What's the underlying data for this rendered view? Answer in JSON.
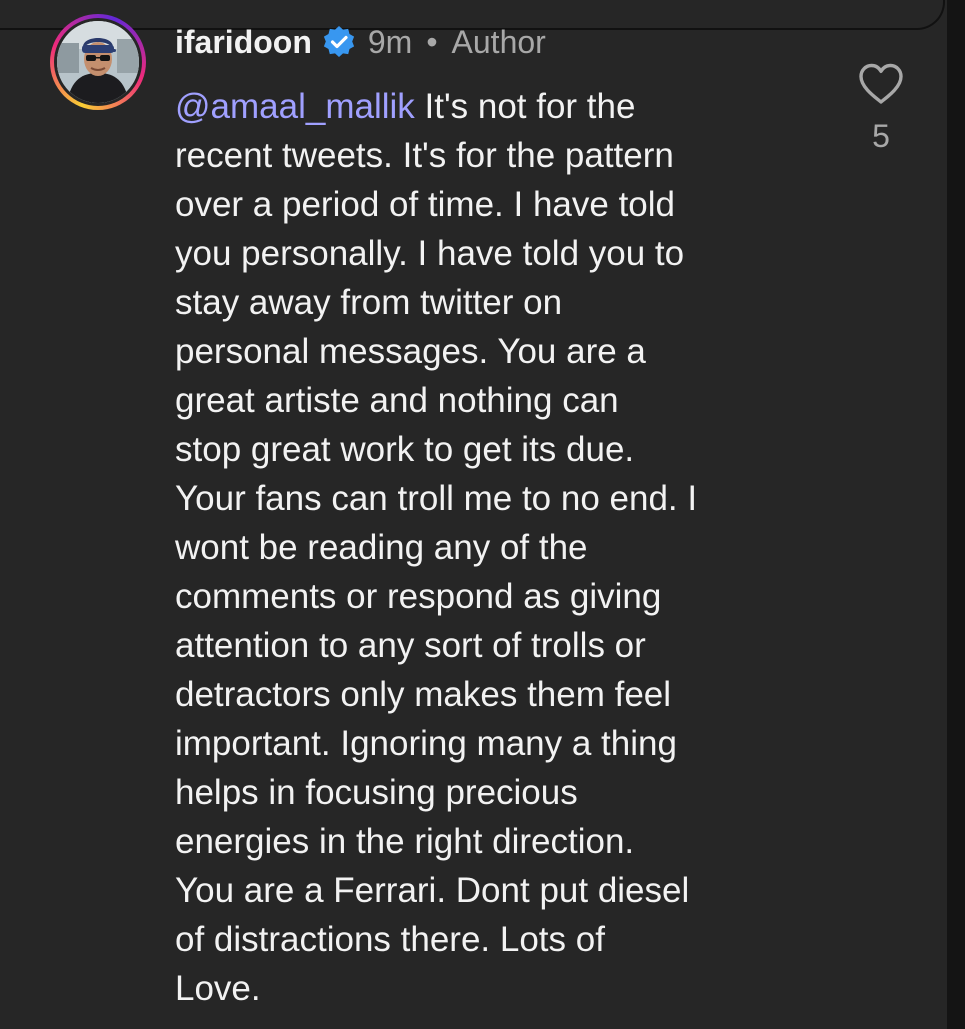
{
  "comment": {
    "username": "ifaridoon",
    "verified": true,
    "time": "9m",
    "separator": "•",
    "role_badge": "Author",
    "mention": "@amaal_mallik",
    "text": " It's not for the\nrecent tweets. It's for the pattern\nover a period of time. I have told\nyou personally. I have told you to\nstay away from twitter on\npersonal messages. You are a\ngreat artiste and nothing can\nstop great work to get its due.\nYour fans can troll me to no end. I\nwont be reading any of the\ncomments or respond as giving\nattention to any sort of trolls or\ndetractors only makes them feel\nimportant. Ignoring many a thing\nhelps in focusing precious\nenergies in the right direction.\nYou are a Ferrari. Dont put diesel\nof distractions there. Lots of\nLove.",
    "like_count": "5",
    "icons": {
      "avatar": "profile-photo",
      "verified": "verified-badge-icon",
      "like": "heart-outline-icon"
    }
  },
  "colors": {
    "background": "#262626",
    "text": "#f2f2f2",
    "muted": "#a8a8a8",
    "mention": "#a0a0ff",
    "verified": "#3897f0"
  }
}
